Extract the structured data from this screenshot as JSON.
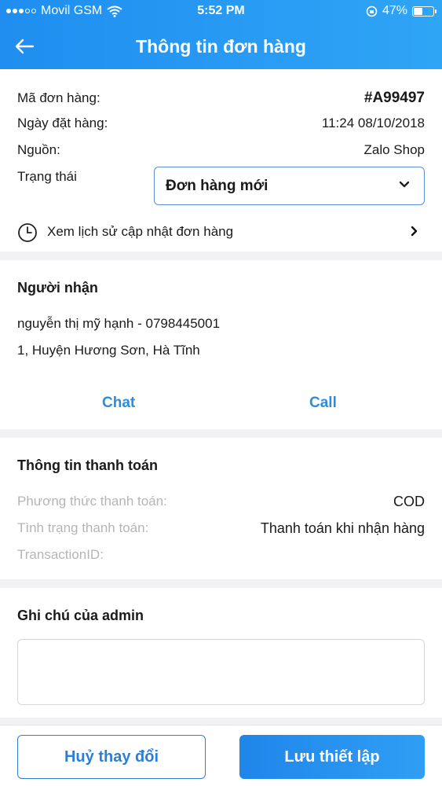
{
  "status_bar": {
    "carrier": "Movil GSM",
    "time": "5:52 PM",
    "battery": "47%",
    "battery_level": 0.47
  },
  "navbar": {
    "title": "Thông tin đơn hàng",
    "back_icon": "back-arrow-icon"
  },
  "order": {
    "id_label": "Mã đơn hàng:",
    "id_value": "#A99497",
    "date_label": "Ngày đặt hàng:",
    "date_value": "11:24 08/10/2018",
    "source_label": "Nguồn:",
    "source_value": "Zalo Shop",
    "status_label": "Trạng thái",
    "status_value": "Đơn hàng mới",
    "history_label": "Xem lịch sử cập nhật đơn hàng"
  },
  "recipient": {
    "title": "Người nhận",
    "name_phone": "nguyễn thị mỹ hạnh - 0798445001",
    "address": "1, Huyện Hương Sơn, Hà Tĩnh",
    "chat_label": "Chat",
    "call_label": "Call"
  },
  "payment": {
    "title": "Thông tin thanh toán",
    "method_label": "Phương thức thanh toán:",
    "method_value": "COD",
    "status_label": "Tình trạng thanh toán:",
    "status_value": "Thanh toán khi nhận hàng",
    "transaction_label": "TransactionID:"
  },
  "admin_note": {
    "title": "Ghi chú của admin",
    "value": ""
  },
  "footer": {
    "cancel_label": "Huỷ thay đổi",
    "save_label": "Lưu thiết lập"
  },
  "colors": {
    "primary": "#2d8ce0",
    "header_gradient_start": "#1f8ef0",
    "header_gradient_end": "#2fa5f6",
    "muted_text": "#b5b5b5"
  }
}
